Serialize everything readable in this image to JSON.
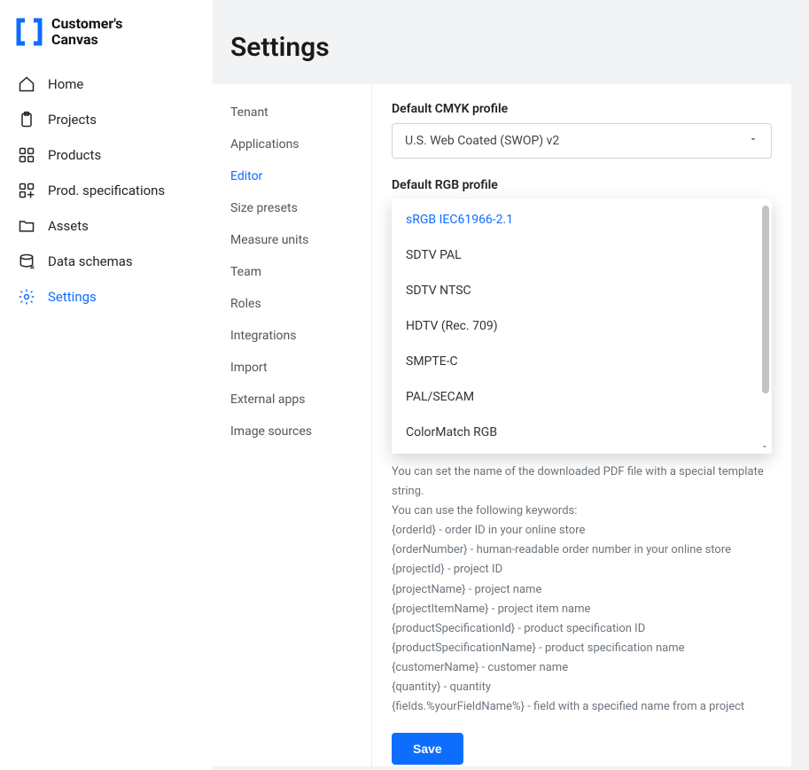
{
  "brand": {
    "line1": "Customer's",
    "line2": "Canvas"
  },
  "sidebar": {
    "items": [
      {
        "label": "Home"
      },
      {
        "label": "Projects"
      },
      {
        "label": "Products"
      },
      {
        "label": "Prod. specifications"
      },
      {
        "label": "Assets"
      },
      {
        "label": "Data schemas"
      },
      {
        "label": "Settings"
      }
    ],
    "active_index": 6
  },
  "page": {
    "title": "Settings"
  },
  "subnav": {
    "items": [
      {
        "label": "Tenant"
      },
      {
        "label": "Applications"
      },
      {
        "label": "Editor"
      },
      {
        "label": "Size presets"
      },
      {
        "label": "Measure units"
      },
      {
        "label": "Team"
      },
      {
        "label": "Roles"
      },
      {
        "label": "Integrations"
      },
      {
        "label": "Import"
      },
      {
        "label": "External apps"
      },
      {
        "label": "Image sources"
      }
    ],
    "active_index": 2
  },
  "form": {
    "cmyk_label": "Default CMYK profile",
    "cmyk_value": "U.S. Web Coated (SWOP) v2",
    "rgb_label": "Default RGB profile",
    "rgb_selected": "sRGB IEC61966-2.1",
    "rgb_options": [
      "sRGB IEC61966-2.1",
      "SDTV PAL",
      "SDTV NTSC",
      "HDTV (Rec. 709)",
      "SMPTE-C",
      "PAL/SECAM",
      "ColorMatch RGB"
    ],
    "help": {
      "intro": "You can set the name of the downloaded PDF file with a special template string.",
      "keywords_header": "You can use the following keywords:",
      "lines": [
        "{orderId} - order ID in your online store",
        "{orderNumber} - human-readable order number in your online store",
        "{projectId} - project ID",
        "{projectName} - project name",
        "{projectItemName} - project item name",
        "{productSpecificationId} - product specification ID",
        "{productSpecificationName} - product specification name",
        "{customerName} - customer name",
        "{quantity} - quantity",
        "{fields.%yourFieldName%} - field with a specified name from a project"
      ]
    },
    "save_label": "Save"
  }
}
